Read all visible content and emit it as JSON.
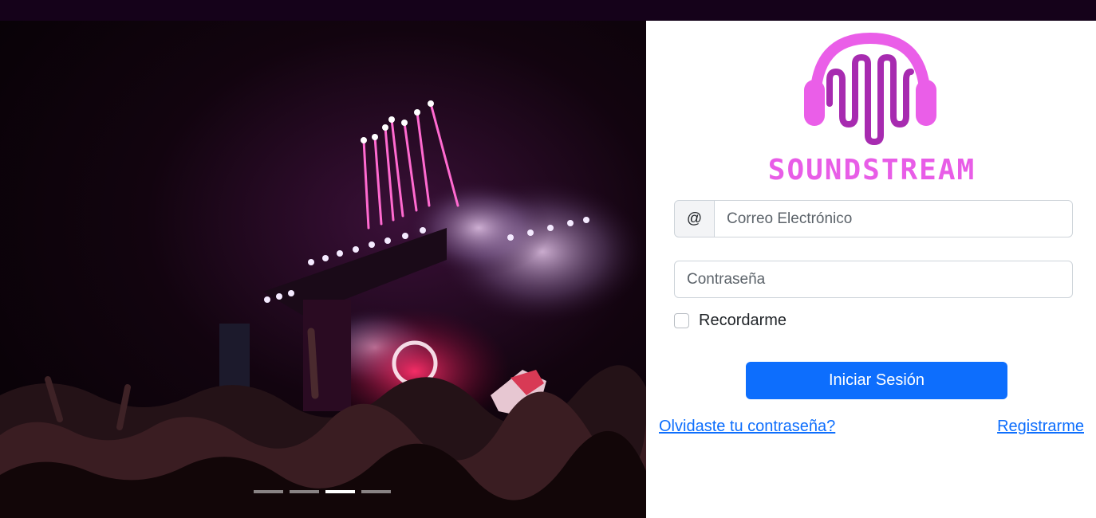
{
  "brand": {
    "name": "SOUNDSTREAM",
    "logo_icon": "headphones-soundwave-icon",
    "colors": {
      "pink": "#e85de7",
      "purple": "#9b1f9d"
    }
  },
  "carousel": {
    "image": "concert-crowd-fireworks-photo",
    "slide_count": 4,
    "active_slide": 3
  },
  "login": {
    "email_addon": "@",
    "email_placeholder": "Correo Electrónico",
    "password_placeholder": "Contraseña",
    "remember_label": "Recordarme",
    "remember_checked": false,
    "submit_label": "Iniciar Sesión",
    "forgot_link": "Olvidaste tu contraseña?",
    "register_link": "Registrarme"
  },
  "colors": {
    "topbar": "#15021a",
    "primary": "#0d6efd",
    "input_border": "#ced4da"
  }
}
